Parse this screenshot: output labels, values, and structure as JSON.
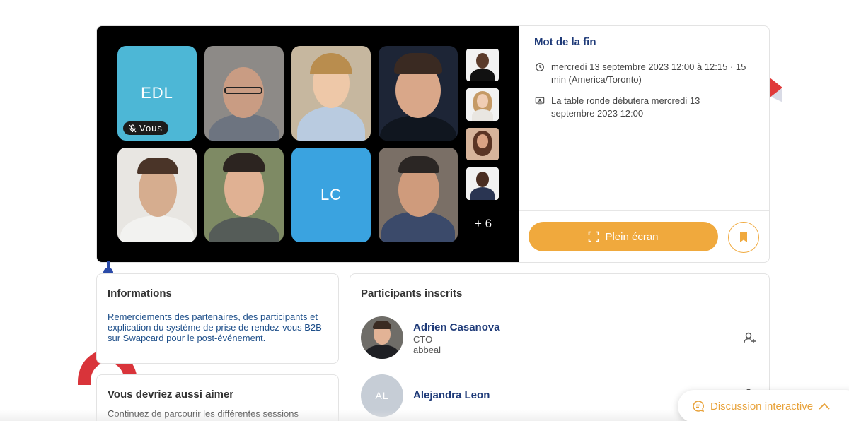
{
  "video": {
    "tiles": [
      {
        "initials": "EDL",
        "you_label": "Vous"
      },
      {
        "initials": "LC"
      }
    ],
    "more_count": "+ 6"
  },
  "session": {
    "title": "Mot de la fin",
    "datetime": "mercredi 13 septembre 2023 12:00 à 12:15 · 15 min (America/Toronto)",
    "start_notice": "La table ronde débutera mercredi 13 septembre 2023 12:00",
    "fullscreen_label": "Plein écran"
  },
  "informations": {
    "title": "Informations",
    "description": "Remerciements des partenaires, des participants et explication du système de prise de rendez-vous B2B sur Swapcard pour le post-événement."
  },
  "aimer": {
    "title": "Vous devriez aussi aimer",
    "text": "Continuez de parcourir les différentes sessions"
  },
  "participants": {
    "title": "Participants inscrits",
    "list": [
      {
        "name": "Adrien Casanova",
        "role": "CTO",
        "company": "abbeal"
      },
      {
        "name": "Alejandra Leon",
        "initials": "AL"
      }
    ]
  },
  "chat": {
    "label": "Discussion interactive"
  },
  "colors": {
    "accent": "#f0a93d",
    "title_blue": "#1e3a78",
    "tile_blue": "#4db7d6"
  }
}
